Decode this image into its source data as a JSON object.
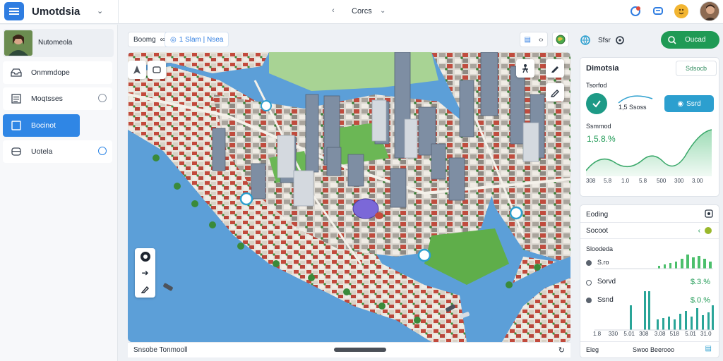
{
  "app": {
    "title": "Umotdsia",
    "center_title": "Corcs",
    "colors": {
      "accent": "#2f86e5",
      "success": "#1f9a55",
      "teal": "#2c9fcf"
    }
  },
  "sidebar": {
    "profile_name": "Nutomeola",
    "items": [
      {
        "label": "Onmmdope",
        "icon": "inbox-icon"
      },
      {
        "label": "Moqtsses",
        "icon": "list-icon"
      },
      {
        "label": "Bocinot",
        "icon": "folder-icon",
        "active": true
      },
      {
        "label": "Uotela",
        "icon": "storage-icon"
      }
    ]
  },
  "map_toolbar": {
    "layer_chip": "Boomg",
    "path_chip": "1 Slam  |  Nsea"
  },
  "map_footer": {
    "text": "Snsobe Tonmooll"
  },
  "right": {
    "header_label": "Sfsr",
    "action_label": "Oucad",
    "card1": {
      "title": "Dimotsia",
      "search_text": "Sdsocb",
      "subtitle": "Tsorfod",
      "range_text": "1,5 Ssoss",
      "pill_label": "Ssrd",
      "metric_label": "Ssmmod",
      "metric_value": "1,5.8.%",
      "axis_ticks": [
        "308",
        "5.8",
        "1.0",
        "5.8",
        "500",
        "300",
        "3.00"
      ]
    },
    "card2": {
      "title": "Eoding",
      "row1_label": "Socoot",
      "section_label": "Sloodeda",
      "row_a_label": "S.ro",
      "row_b_label": "Sorvd",
      "row_b_value": "$.3.%",
      "row_c_label": "Ssnd",
      "row_c_value": "$.0.%",
      "axis_ticks": [
        "1.8",
        "330",
        "5.01",
        "308",
        "3.08",
        "518",
        "5.01",
        "31.0"
      ],
      "footer_left": "Eleg",
      "footer_mid": "Swoo Beerooo"
    }
  }
}
